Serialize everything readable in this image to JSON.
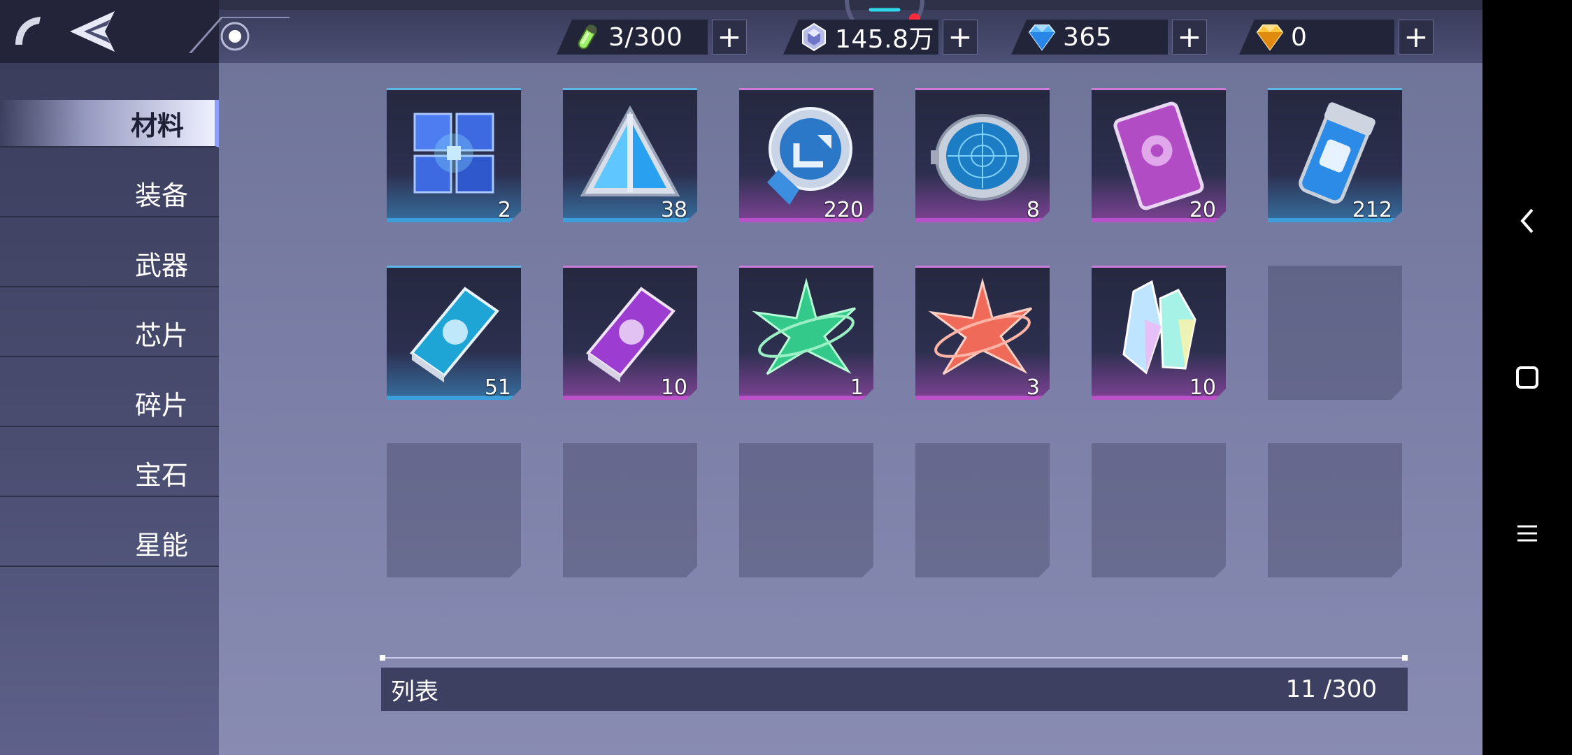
{
  "resources": [
    {
      "icon": "stamina-vial-icon",
      "value": "3/300"
    },
    {
      "icon": "crystal-coin-icon",
      "value": "145.8万"
    },
    {
      "icon": "blue-diamond-icon",
      "value": "365"
    },
    {
      "icon": "gold-diamond-icon",
      "value": "0"
    }
  ],
  "plus_label": "+",
  "sidebar": {
    "items": [
      {
        "label": "材料",
        "active": true
      },
      {
        "label": "装备"
      },
      {
        "label": "武器"
      },
      {
        "label": "芯片"
      },
      {
        "label": "碎片"
      },
      {
        "label": "宝石"
      },
      {
        "label": "星能"
      }
    ]
  },
  "inventory": {
    "items": [
      {
        "icon": "blue-cube-icon",
        "count": "2",
        "rarity": "blue"
      },
      {
        "icon": "blue-pyramid-crystal-icon",
        "count": "38",
        "rarity": "blue"
      },
      {
        "icon": "upgrade-medal-icon",
        "count": "220",
        "rarity": "purple"
      },
      {
        "icon": "radar-compass-icon",
        "count": "8",
        "rarity": "purple"
      },
      {
        "icon": "purple-card-icon",
        "count": "20",
        "rarity": "purple"
      },
      {
        "icon": "power-fist-canister-icon",
        "count": "212",
        "rarity": "blue"
      },
      {
        "icon": "blue-wolf-book-icon",
        "count": "51",
        "rarity": "blue"
      },
      {
        "icon": "purple-wolf-book-icon",
        "count": "10",
        "rarity": "purple"
      },
      {
        "icon": "green-star-crystal-icon",
        "count": "1",
        "rarity": "purple"
      },
      {
        "icon": "red-star-crystal-icon",
        "count": "3",
        "rarity": "purple"
      },
      {
        "icon": "prism-crystal-icon",
        "count": "10",
        "rarity": "purple"
      }
    ],
    "empty_slots": 7
  },
  "footer": {
    "label": "列表",
    "capacity": "11 /300"
  },
  "system_nav": {
    "back": "chevron-left-icon",
    "home": "square-icon",
    "menu": "hamburger-icon"
  }
}
